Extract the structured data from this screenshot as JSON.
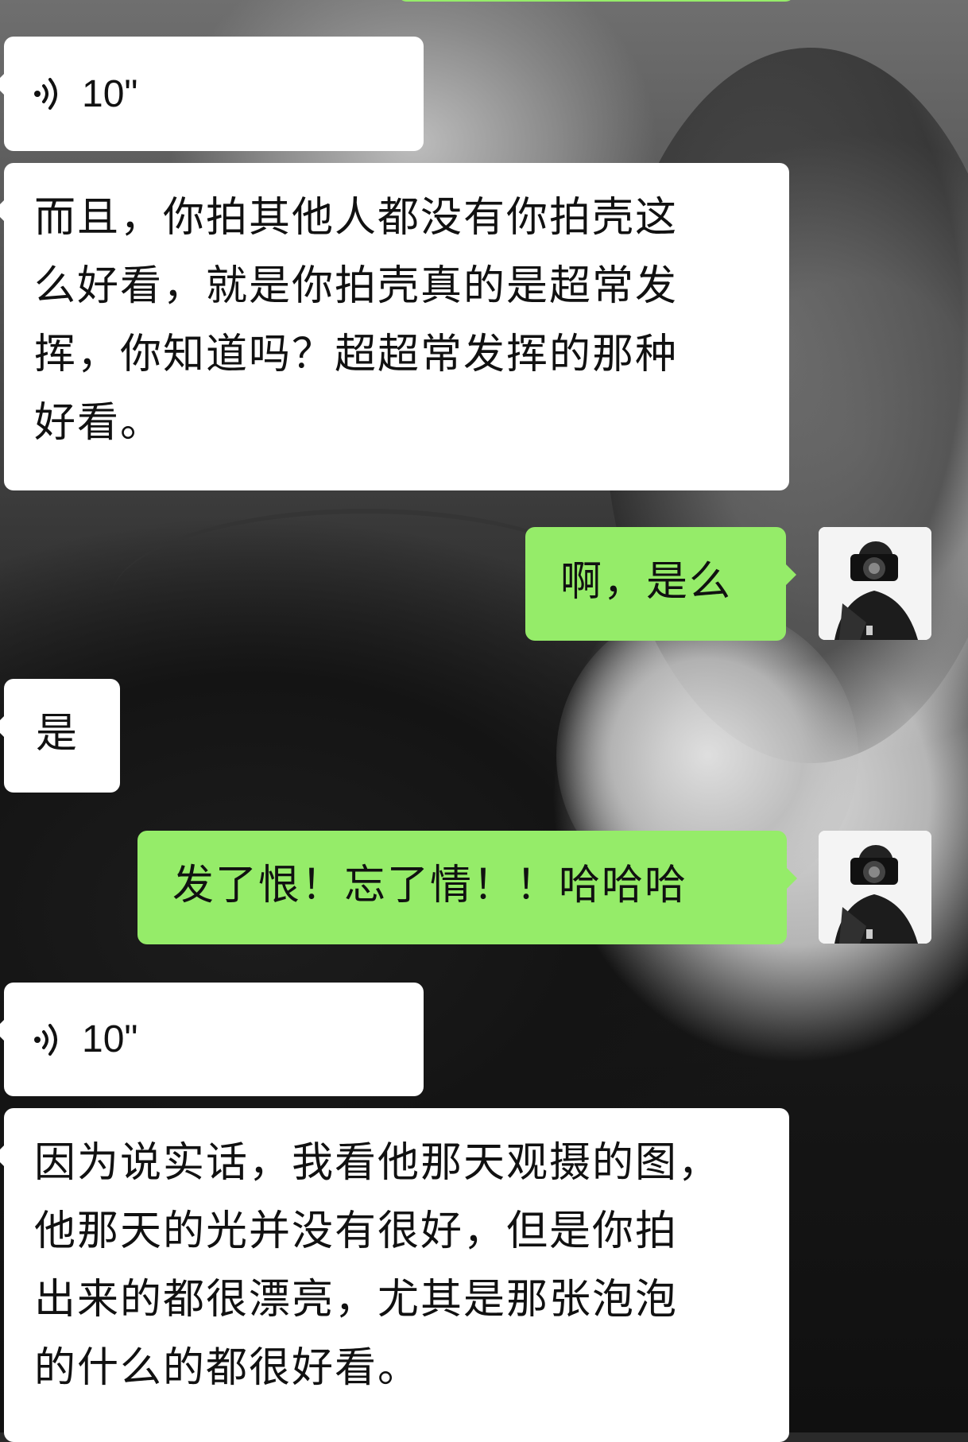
{
  "messages": [
    {
      "kind": "voice",
      "side": "left",
      "duration": "10\""
    },
    {
      "kind": "text",
      "side": "left",
      "text": "而且，你拍其他人都没有你拍壳这\n么好看，就是你拍壳真的是超常发\n挥，你知道吗？超超常发挥的那种\n好看。"
    },
    {
      "kind": "text",
      "side": "right",
      "text": "啊，是么"
    },
    {
      "kind": "text",
      "side": "left",
      "text": "是"
    },
    {
      "kind": "text",
      "side": "right",
      "text": "发了恨！忘了情！！哈哈哈"
    },
    {
      "kind": "voice",
      "side": "left",
      "duration": "10\""
    },
    {
      "kind": "text",
      "side": "left",
      "text": "因为说实话，我看他那天观摄的图，\n他那天的光并没有很好，但是你拍\n出来的都很漂亮，尤其是那张泡泡\n的什么的都很好看。"
    }
  ],
  "colors": {
    "sent_bubble": "#95ec69",
    "received_bubble": "#ffffff"
  },
  "icons": {
    "voice": "voice-wave-icon",
    "avatar": "self-avatar-camera-photo"
  }
}
